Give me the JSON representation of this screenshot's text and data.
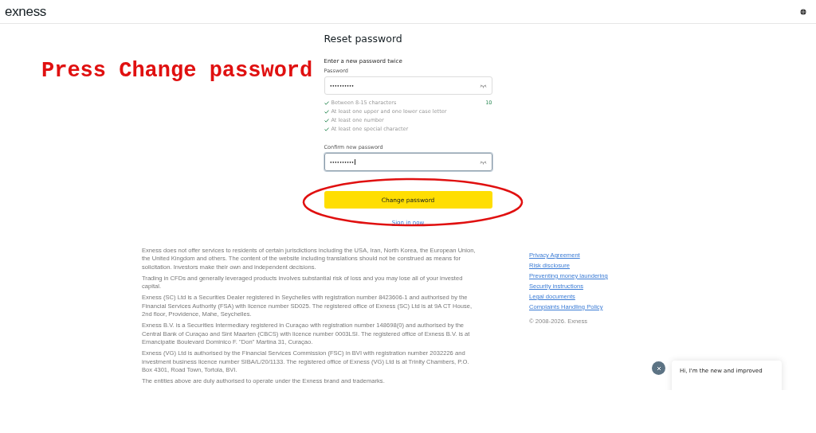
{
  "header": {
    "logo": "exness"
  },
  "annotation": {
    "text": "Press Change password"
  },
  "form": {
    "title": "Reset password",
    "subtitle": "Enter a new password twice",
    "password": {
      "label": "Password",
      "value": "••••••••••",
      "counter": "10"
    },
    "rules": [
      {
        "text": "Between 8-15 characters",
        "met": true
      },
      {
        "text": "At least one upper and one lower case letter",
        "met": true
      },
      {
        "text": "At least one number",
        "met": true
      },
      {
        "text": "At least one special character",
        "met": true
      }
    ],
    "confirm": {
      "label": "Confirm new password",
      "value": "••••••••••",
      "focused": true
    },
    "submit": "Change password",
    "sign_in": "Sign in now"
  },
  "footer": {
    "paragraphs": [
      "Exness does not offer services to residents of certain jurisdictions including the USA, Iran, North Korea, the European Union, the United Kingdom and others. The content of the website including translations should not be construed as means for solicitation. Investors make their own and independent decisions.",
      "Trading in CFDs and generally leveraged products involves substantial risk of loss and you may lose all of your invested capital.",
      "Exness (SC) Ltd is a Securities Dealer registered in Seychelles with registration number 8423606-1 and authorised by the Financial Services Authority (FSA) with licence number SD025. The registered office of Exness (SC) Ltd is at 9A CT House, 2nd floor, Providence, Mahe, Seychelles.",
      "Exness B.V. is a Securities Intermediary registered in Curaçao with registration number 148698(0) and authorised by the Central Bank of Curaçao and Sint Maarten (CBCS) with licence number 0003LSI. The registered office of Exness B.V. is at Emancipatie Boulevard Dominico F. \"Don\" Martina 31, Curaçao.",
      "Exness (VG) Ltd is authorised by the Financial Services Commission (FSC) in BVI with registration number 2032226 and investment business licence number SIBA/L/20/1133. The registered office of Exness (VG) Ltd is at Trinity Chambers, P.O. Box 4301, Road Town, Tortola, BVI.",
      "The entities above are duly authorised to operate under the Exness brand and trademarks."
    ],
    "links": [
      "Privacy Agreement",
      "Risk disclosure",
      "Preventing money laundering",
      "Security instructions",
      "Legal documents",
      "Complaints Handling Policy"
    ],
    "copyright": "© 2008-2026. Exness"
  },
  "chat": {
    "message": "Hi, I'm the new and improved"
  }
}
